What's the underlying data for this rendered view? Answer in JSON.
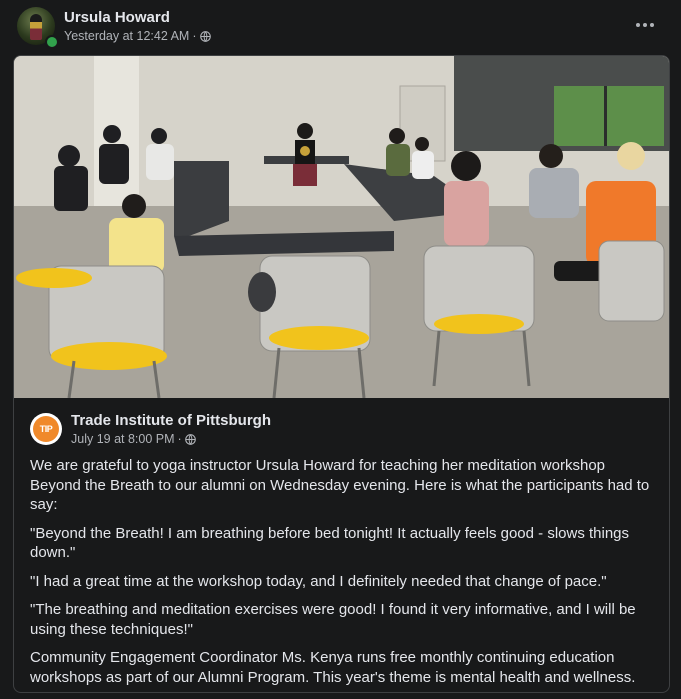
{
  "post": {
    "author": "Ursula Howard",
    "timestamp": "Yesterday at 12:42 AM",
    "separator": "·",
    "audience_icon": "globe-icon",
    "more_icon": "more-dots-icon"
  },
  "shared": {
    "photo": {
      "image_icon": "workshop-photo"
    },
    "page_name": "Trade Institute of Pittsburgh",
    "page_logo_text": "TIP",
    "timestamp": "July 19 at 8:00 PM",
    "separator": "·",
    "paragraphs": [
      "We are grateful to yoga instructor Ursula Howard for teaching her meditation workshop Beyond the Breath to our alumni on Wednesday evening. Here is what the participants had to say:",
      "\"Beyond the Breath! I am breathing before bed tonight! It actually feels good - slows things down.\"",
      "\"I had a great time at the workshop today, and I definitely needed that change of pace.\"",
      "\"The breathing and meditation exercises were good! I found it very informative, and I will be using these techniques!\"",
      "Community Engagement Coordinator Ms. Kenya runs free monthly continuing education workshops as part of our Alumni Program. This year's theme is mental health and wellness."
    ]
  },
  "colors": {
    "background": "#18191a",
    "primary_text": "#e4e6eb",
    "secondary_text": "#b0b3b8",
    "online": "#31a24c",
    "card_border": "#3e4042"
  }
}
